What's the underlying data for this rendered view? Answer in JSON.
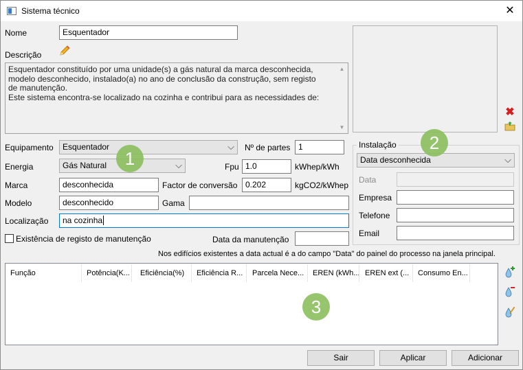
{
  "window": {
    "title": "Sistema técnico"
  },
  "nome": {
    "label": "Nome",
    "value": "Esquentador"
  },
  "descricao": {
    "label": "Descrição",
    "lines": [
      "Esquentador constituído por uma unidade(s) a gás natural da marca desconhecida,",
      "modelo desconhecido, instalado(a) no ano de conclusão da construção, sem registo",
      "de manutenção.",
      "Este sistema encontra-se localizado na cozinha e contribui para as necessidades de:"
    ]
  },
  "equipamento": {
    "label": "Equipamento",
    "value": "Esquentador"
  },
  "n_partes": {
    "label": "Nº de partes",
    "value": "1"
  },
  "energia": {
    "label": "Energia",
    "value": "Gás Natural"
  },
  "fpu": {
    "label": "Fpu",
    "value": "1.0",
    "unit": "kWhep/kWh"
  },
  "marca": {
    "label": "Marca",
    "value": "desconhecida"
  },
  "factor": {
    "label": "Factor de conversão",
    "value": "0.202",
    "unit": "kgCO2/kWhep"
  },
  "modelo": {
    "label": "Modelo",
    "value": "desconhecido"
  },
  "gama": {
    "label": "Gama",
    "value": ""
  },
  "localizacao": {
    "label": "Localização",
    "value": "na cozinha"
  },
  "registo": {
    "label": "Existência de registo de manutenção",
    "checked": false
  },
  "data_manutencao": {
    "label": "Data da manutenção",
    "value": ""
  },
  "instalacao": {
    "title": "Instalação",
    "select_value": "Data desconhecida",
    "data_label": "Data",
    "empresa_label": "Empresa",
    "telefone_label": "Telefone",
    "email_label": "Email"
  },
  "note": "Nos edifícios existentes a data actual é a do campo \"Data\" do painel do processo na janela principal.",
  "table": {
    "columns": [
      "Função",
      "Potência(K...",
      "Eficiência(%)",
      "Eficiência R...",
      "Parcela Nece...",
      "EREN (kWh...",
      "EREN ext (...",
      "Consumo En..."
    ]
  },
  "badges": [
    "1",
    "2",
    "3"
  ],
  "buttons": {
    "sair": "Sair",
    "aplicar": "Aplicar",
    "adicionar": "Adicionar"
  },
  "icons": {
    "close": "close-icon",
    "edit": "pencil-icon",
    "delete": "red-x-icon",
    "open": "folder-icon",
    "add_row": "add-row-icon",
    "remove_row": "remove-row-icon",
    "edit_row": "edit-row-icon"
  },
  "colors": {
    "badge": "#8cbf5e",
    "focus_border": "#0078d7",
    "delete_red": "#d32020"
  }
}
